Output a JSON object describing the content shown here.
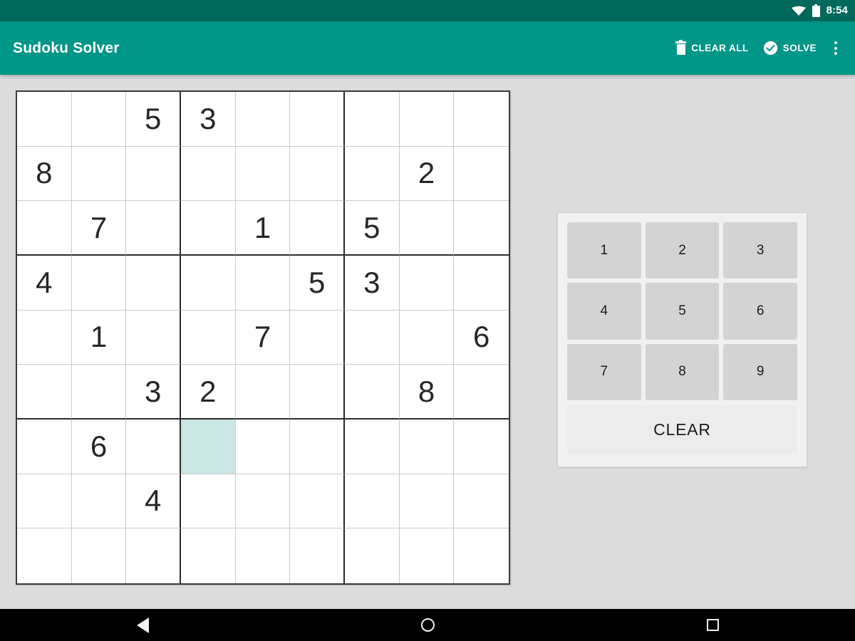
{
  "status_bar": {
    "time": "8:54",
    "wifi_icon": "wifi-icon",
    "battery_icon": "battery-icon"
  },
  "app_bar": {
    "title": "Sudoku Solver",
    "clear_all_label": "CLEAR ALL",
    "clear_all_icon": "trash-icon",
    "solve_label": "SOLVE",
    "solve_icon": "check-circle-icon",
    "overflow_icon": "overflow-menu-icon",
    "background_color": "#009688"
  },
  "colors": {
    "status_bar": "#00695c",
    "app_bar": "#009688",
    "page_background": "#dcdcdc",
    "cell_selected": "#c9e6e5",
    "grid_line_thin": "#c9c9c9",
    "grid_line_thick": "#2b2b2b",
    "number_button": "#d3d3d3",
    "clear_button": "#ececec"
  },
  "sudoku": {
    "selected_cell": {
      "row": 7,
      "col": 4
    },
    "rows": [
      [
        "",
        "",
        "5",
        "3",
        "",
        "",
        "",
        "",
        ""
      ],
      [
        "8",
        "",
        "",
        "",
        "",
        "",
        "",
        "2",
        ""
      ],
      [
        "",
        "7",
        "",
        "",
        "1",
        "",
        "5",
        "",
        ""
      ],
      [
        "4",
        "",
        "",
        "",
        "",
        "5",
        "3",
        "",
        ""
      ],
      [
        "",
        "1",
        "",
        "",
        "7",
        "",
        "",
        "",
        "6"
      ],
      [
        "",
        "",
        "3",
        "2",
        "",
        "",
        "",
        "8",
        ""
      ],
      [
        "",
        "6",
        "",
        "",
        "",
        "",
        "",
        "",
        ""
      ],
      [
        "",
        "",
        "4",
        "",
        "",
        "",
        "",
        "",
        ""
      ],
      [
        "",
        "",
        "",
        "",
        "",
        "",
        "",
        "",
        ""
      ]
    ]
  },
  "number_pad": {
    "buttons": [
      "1",
      "2",
      "3",
      "4",
      "5",
      "6",
      "7",
      "8",
      "9"
    ],
    "clear_label": "CLEAR"
  },
  "nav_bar": {
    "back_icon": "back-triangle-icon",
    "home_icon": "home-circle-icon",
    "recents_icon": "recents-square-icon"
  }
}
